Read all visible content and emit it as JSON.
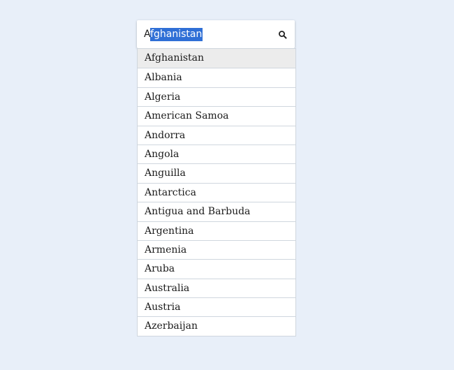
{
  "search": {
    "value_prefix": "A",
    "value_selected": "fghanistan",
    "icon": "search-icon"
  },
  "dropdown": {
    "active_index": 0,
    "options": [
      "Afghanistan",
      "Albania",
      "Algeria",
      "American Samoa",
      "Andorra",
      "Angola",
      "Anguilla",
      "Antarctica",
      "Antigua and Barbuda",
      "Argentina",
      "Armenia",
      "Aruba",
      "Australia",
      "Austria",
      "Azerbaijan"
    ]
  },
  "colors": {
    "background": "#e8eff9",
    "selection": "#2f6fd6",
    "active_option": "#ececec"
  }
}
